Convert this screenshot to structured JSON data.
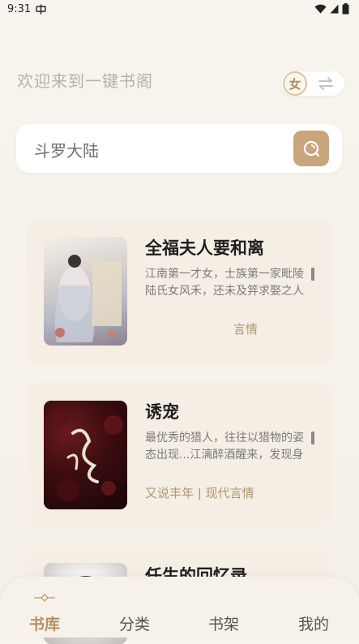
{
  "status_bar": {
    "time": "9:31"
  },
  "header": {
    "welcome": "欢迎来到一键书阁",
    "gender_label": "女"
  },
  "search": {
    "placeholder": "斗罗大陆"
  },
  "books": [
    {
      "title": "全福夫人要和离",
      "desc_line1": "江南第一才女，士族第一家毗陵",
      "desc_line2": "陆氏女风禾，还未及笄求娶之人",
      "meta": "言情"
    },
    {
      "title": "诱宠",
      "desc_line1": "最优秀的猎人，往往以猎物的姿",
      "desc_line2": "态出现...江漓醉酒醒来，发现身",
      "meta": "又说丰年 | 现代言情"
    },
    {
      "title": "任生的回忆录"
    }
  ],
  "tabs": {
    "library": "书库",
    "category": "分类",
    "shelf": "书架",
    "mine": "我的"
  },
  "colors": {
    "accent": "#c9a57c",
    "active_tab": "#b89066"
  }
}
